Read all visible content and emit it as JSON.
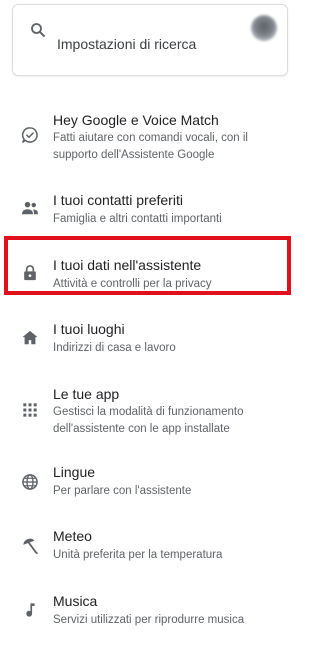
{
  "search": {
    "label": "Impostazioni di ricerca",
    "icon": "search-icon"
  },
  "highlight_color": "#e0101c",
  "items": [
    {
      "icon": "voice-match-icon",
      "title": "Hey Google e Voice Match",
      "subtitle": "Fatti aiutare con comandi vocali, con il supporto dell'Assistente Google"
    },
    {
      "icon": "people-icon",
      "title": "I tuoi contatti preferiti",
      "subtitle": "Famiglia e altri contatti importanti"
    },
    {
      "icon": "lock-icon",
      "title": "I tuoi dati nell'assistente",
      "subtitle": "Attività e controlli per la privacy"
    },
    {
      "icon": "home-icon",
      "title": "I tuoi luoghi",
      "subtitle": "Indirizzi di casa e lavoro"
    },
    {
      "icon": "apps-grid-icon",
      "title": "Le tue app",
      "subtitle": "Gestisci la modalità di funzionamento dell'assistente con le app installate"
    },
    {
      "icon": "globe-icon",
      "title": "Lingue",
      "subtitle": "Per parlare con l'assistente"
    },
    {
      "icon": "weather-icon",
      "title": "Meteo",
      "subtitle": "Unità preferita per la temperatura"
    },
    {
      "icon": "music-note-icon",
      "title": "Musica",
      "subtitle": "Servizi utilizzati per riprodurre musica"
    }
  ]
}
